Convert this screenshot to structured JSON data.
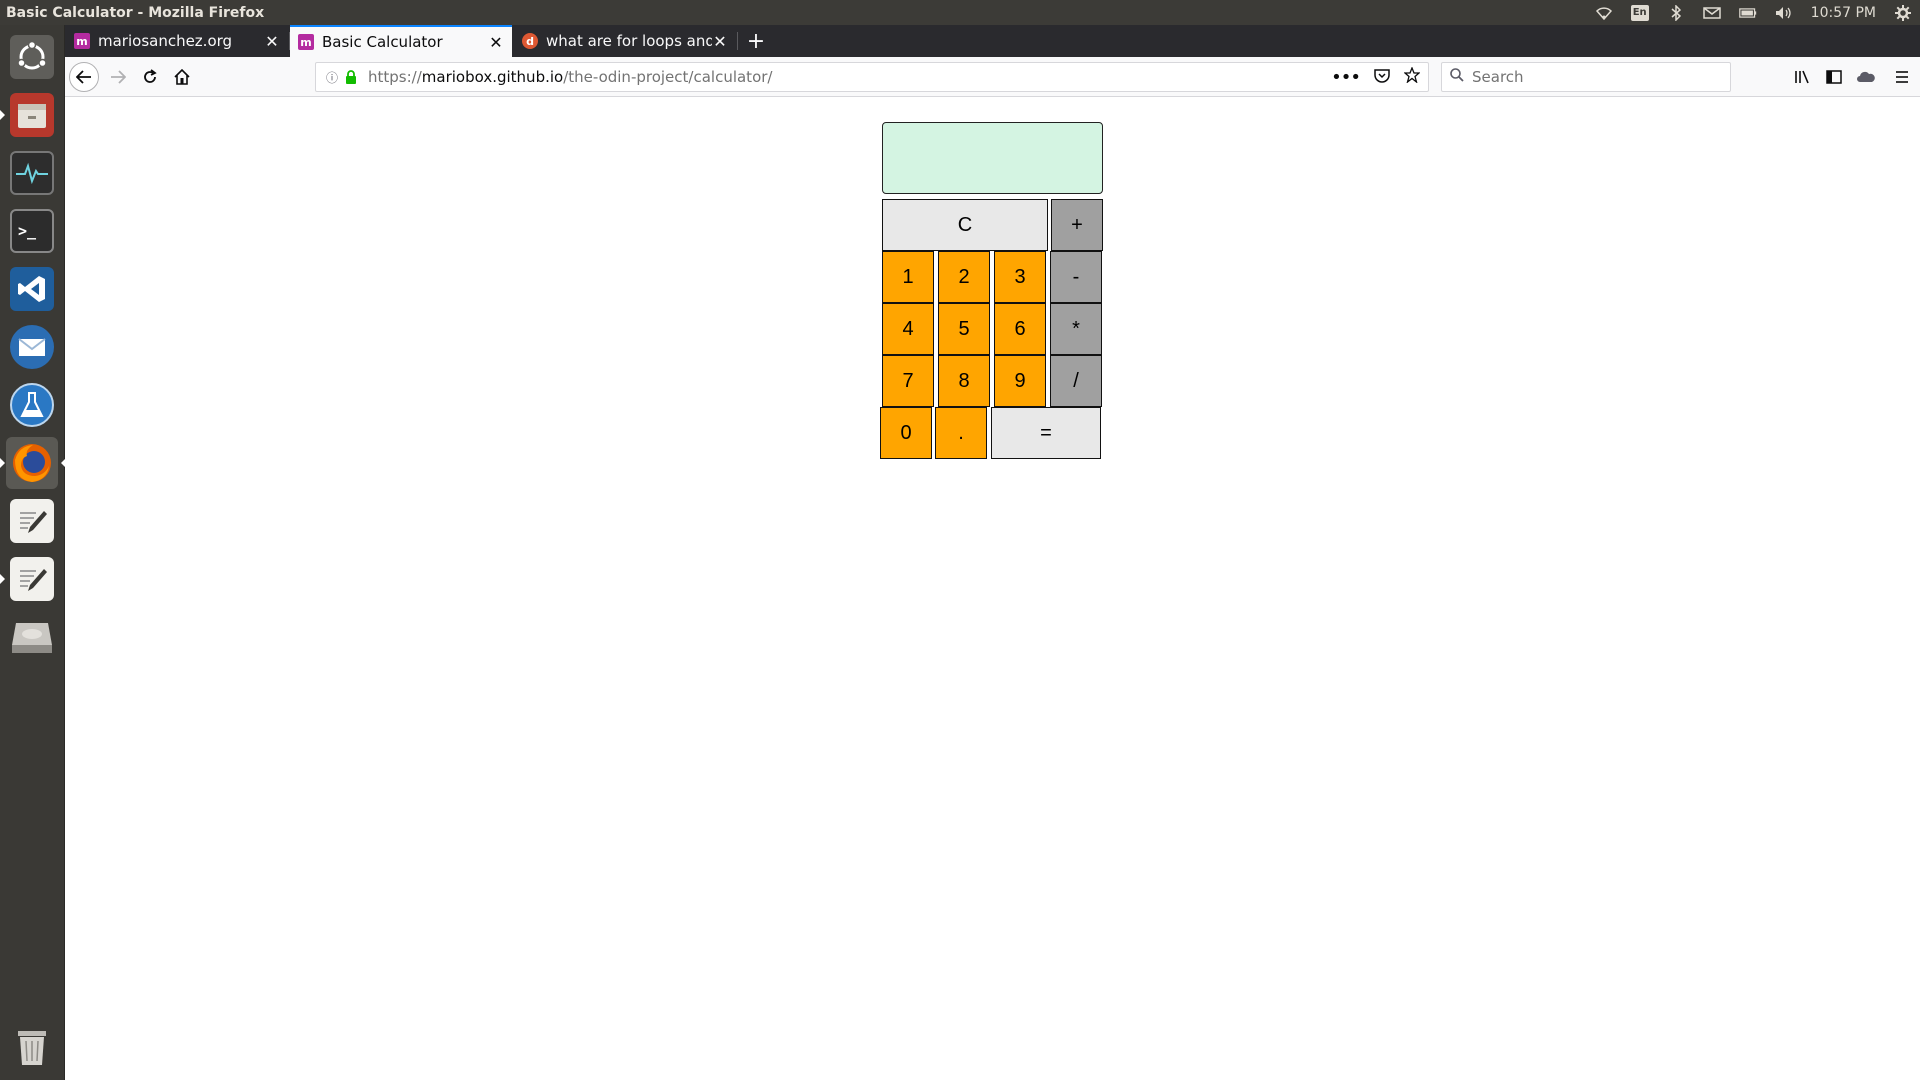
{
  "panel": {
    "window_title": "Basic Calculator - Mozilla Firefox",
    "keyboard_layout": "En",
    "clock": "10:57 PM",
    "indicators": [
      "wifi-icon",
      "keyboard-layout-indicator",
      "bluetooth-icon",
      "mail-icon",
      "battery-icon",
      "volume-icon",
      "session-gear-icon"
    ]
  },
  "launcher": {
    "items": [
      "ubuntu-dash",
      "files",
      "system-monitor",
      "terminal",
      "vscode",
      "thunderbird",
      "lab-app",
      "firefox",
      "text-editor",
      "text-editor-2",
      "disk-drive",
      "trash"
    ]
  },
  "tabs": [
    {
      "label": "mariosanchez.org",
      "favicon": "m",
      "favicon_color": "#b42ba0",
      "active": false
    },
    {
      "label": "Basic Calculator",
      "favicon": "m",
      "favicon_color": "#b42ba0",
      "active": true
    },
    {
      "label": "what are for loops and i",
      "favicon": "d",
      "favicon_color": "#de5833",
      "active": false
    }
  ],
  "new_tab_label": "+",
  "navbar": {
    "url_scheme": "https://",
    "url_host": "mariobox.github.io",
    "url_path": "/the-odin-project/calculator/",
    "search_placeholder": "Search"
  },
  "calculator": {
    "display": "",
    "clear": "C",
    "plus": "+",
    "minus": "-",
    "multiply": "*",
    "divide": "/",
    "equals": "=",
    "dot": ".",
    "digits": [
      "0",
      "1",
      "2",
      "3",
      "4",
      "5",
      "6",
      "7",
      "8",
      "9"
    ]
  },
  "colors": {
    "display_bg": "#d4f4e2",
    "number_key": "#ffa500",
    "operator_key": "#a0a0a0",
    "clear_key": "#e8e8e8"
  }
}
